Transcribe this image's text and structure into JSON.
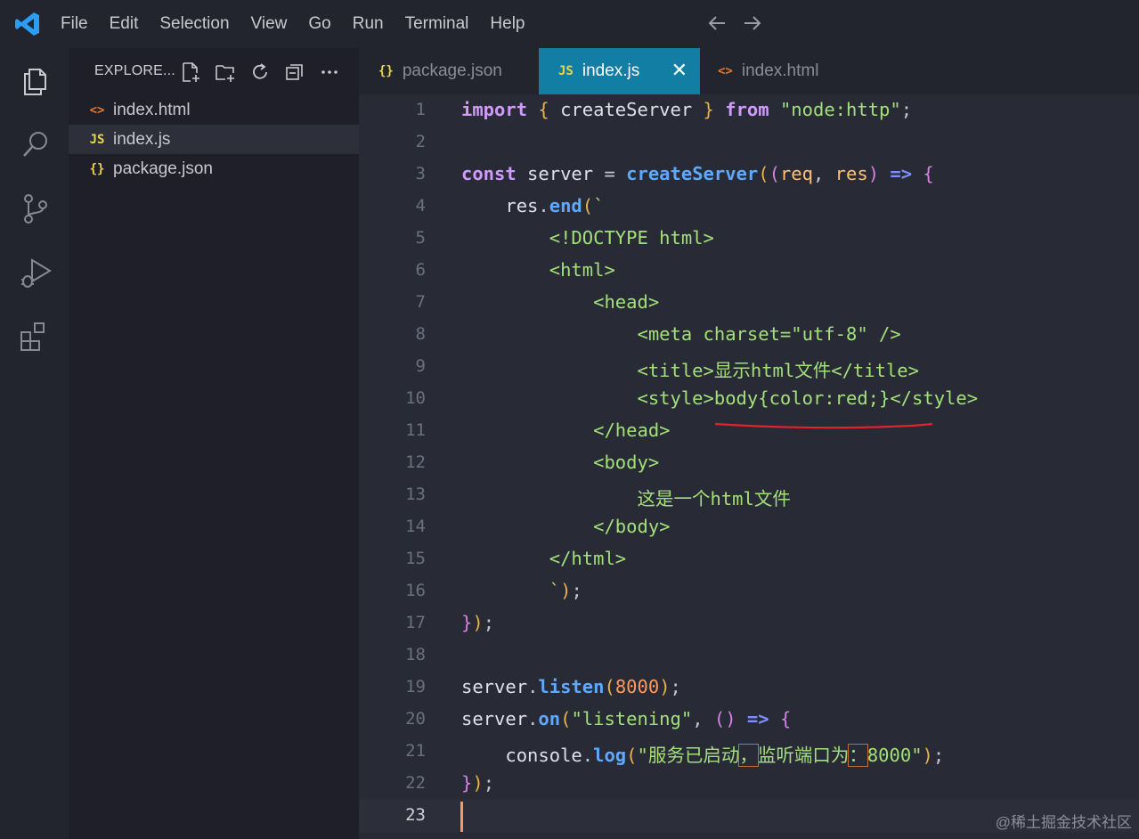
{
  "menu": [
    "File",
    "Edit",
    "Selection",
    "View",
    "Go",
    "Run",
    "Terminal",
    "Help"
  ],
  "explorer": {
    "title": "EXPLORE...",
    "files": [
      {
        "name": "index.html",
        "icon": "<>",
        "icon_color": "#e37933"
      },
      {
        "name": "index.js",
        "icon": "JS",
        "icon_color": "#e8d44d"
      },
      {
        "name": "package.json",
        "icon": "{}",
        "icon_color": "#e8d44d"
      }
    ]
  },
  "tabs": [
    {
      "label": "package.json",
      "icon": "{}",
      "icon_color": "#e8d44d"
    },
    {
      "label": "index.js",
      "icon": "JS",
      "icon_color": "#e8d44d",
      "close": "✕"
    },
    {
      "label": "index.html",
      "icon": "<>",
      "icon_color": "#e37933"
    }
  ],
  "editor": {
    "line_numbers": [
      "1",
      "2",
      "3",
      "4",
      "5",
      "6",
      "7",
      "8",
      "9",
      "10",
      "11",
      "12",
      "13",
      "14",
      "15",
      "16",
      "17",
      "18",
      "19",
      "20",
      "21",
      "22",
      "23"
    ],
    "lines": [
      [
        [
          "import",
          "kw"
        ],
        [
          " ",
          "var"
        ],
        [
          "{",
          "brace"
        ],
        [
          " createServer ",
          "var"
        ],
        [
          "}",
          "brace"
        ],
        [
          " ",
          "var"
        ],
        [
          "from",
          "kw"
        ],
        [
          " ",
          "var"
        ],
        [
          "\"node:http\"",
          "str"
        ],
        [
          ";",
          "punc"
        ]
      ],
      [],
      [
        [
          "const",
          "kw"
        ],
        [
          " server ",
          "var"
        ],
        [
          "=",
          "punc"
        ],
        [
          " ",
          "var"
        ],
        [
          "createServer",
          "fn"
        ],
        [
          "(",
          "paren"
        ],
        [
          "(",
          "paren2"
        ],
        [
          "req",
          "par"
        ],
        [
          ", ",
          "punc"
        ],
        [
          "res",
          "par"
        ],
        [
          ")",
          "paren2"
        ],
        [
          " ",
          "var"
        ],
        [
          "=>",
          "arrow"
        ],
        [
          " ",
          "var"
        ],
        [
          "{",
          "paren2"
        ]
      ],
      [
        [
          "    res",
          "var"
        ],
        [
          ".",
          "punc"
        ],
        [
          "end",
          "fn"
        ],
        [
          "(",
          "paren"
        ],
        [
          "`",
          "str"
        ]
      ],
      [
        [
          "        <!DOCTYPE html>",
          "tag"
        ]
      ],
      [
        [
          "        <html>",
          "tag"
        ]
      ],
      [
        [
          "            <head>",
          "tag"
        ]
      ],
      [
        [
          "                <meta charset=\"utf-8\" />",
          "tag"
        ]
      ],
      [
        [
          "                <title>显示html文件</title>",
          "tag"
        ]
      ],
      [
        [
          "                <style>body{color:red;}</style>",
          "tag"
        ]
      ],
      [
        [
          "            </head>",
          "tag"
        ]
      ],
      [
        [
          "            <body>",
          "tag"
        ]
      ],
      [
        [
          "                这是一个html文件",
          "tag"
        ]
      ],
      [
        [
          "            </body>",
          "tag"
        ]
      ],
      [
        [
          "        </html>",
          "tag"
        ]
      ],
      [
        [
          "        `",
          "str"
        ],
        [
          ")",
          "paren"
        ],
        [
          ";",
          "punc"
        ]
      ],
      [
        [
          "}",
          "paren2"
        ],
        [
          ")",
          "paren"
        ],
        [
          ";",
          "punc"
        ]
      ],
      [],
      [
        [
          "server",
          "var"
        ],
        [
          ".",
          "punc"
        ],
        [
          "listen",
          "fn"
        ],
        [
          "(",
          "paren"
        ],
        [
          "8000",
          "num"
        ],
        [
          ")",
          "paren"
        ],
        [
          ";",
          "punc"
        ]
      ],
      [
        [
          "server",
          "var"
        ],
        [
          ".",
          "punc"
        ],
        [
          "on",
          "fn"
        ],
        [
          "(",
          "paren"
        ],
        [
          "\"listening\"",
          "str"
        ],
        [
          ", ",
          "punc"
        ],
        [
          "()",
          "paren2"
        ],
        [
          " ",
          "var"
        ],
        [
          "=>",
          "arrow"
        ],
        [
          " ",
          "var"
        ],
        [
          "{",
          "paren2"
        ]
      ],
      [
        [
          "    console",
          "var"
        ],
        [
          ".",
          "punc"
        ],
        [
          "log",
          "fn"
        ],
        [
          "(",
          "paren"
        ],
        [
          "\"服务已启动",
          "str"
        ],
        [
          "，",
          "strbox"
        ],
        [
          "监听端口为",
          "str"
        ],
        [
          "：",
          "strbox"
        ],
        [
          "8000\"",
          "str"
        ],
        [
          ")",
          "paren"
        ],
        [
          ";",
          "punc"
        ]
      ],
      [
        [
          "}",
          "paren2"
        ],
        [
          ")",
          "paren"
        ],
        [
          ";",
          "punc"
        ]
      ],
      []
    ]
  },
  "watermark": "@稀土掘金技术社区"
}
